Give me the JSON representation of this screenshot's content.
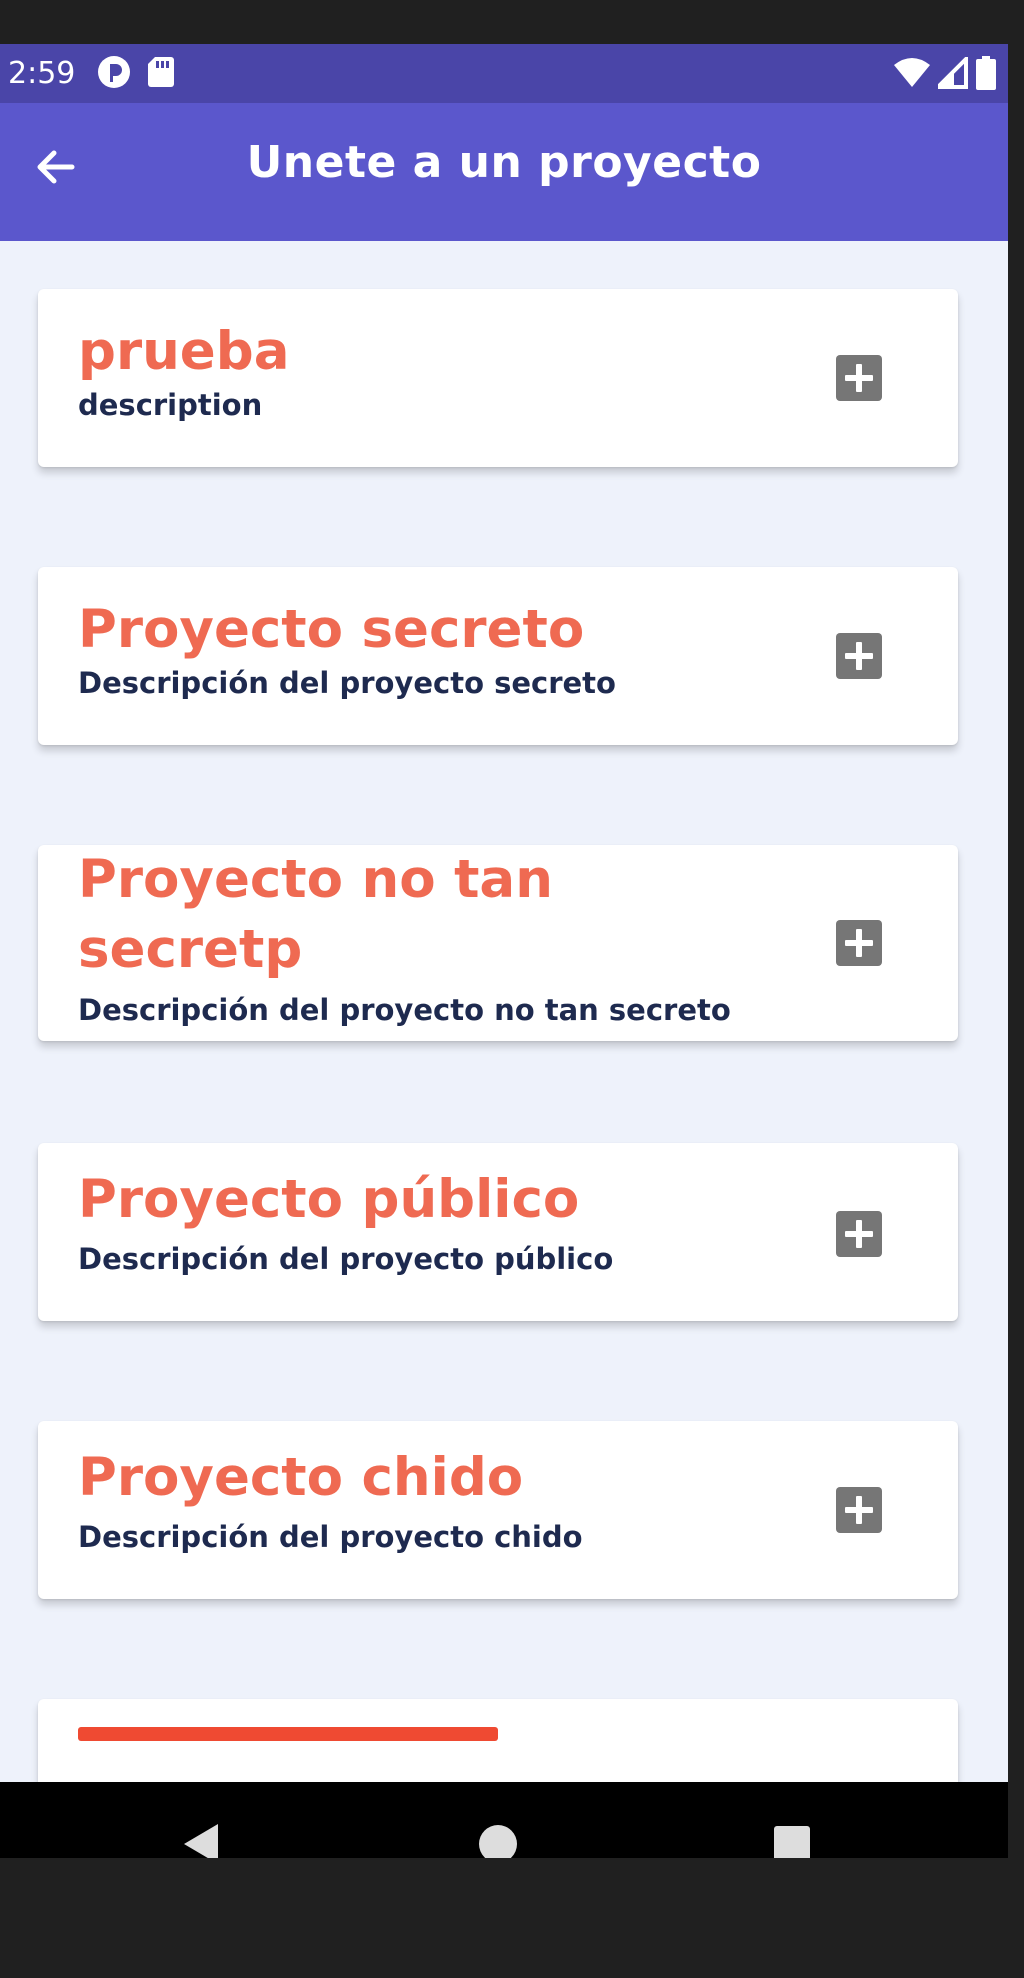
{
  "status_bar": {
    "time": "2:59",
    "icons": [
      "p-circle-icon",
      "sd-card-icon",
      "wifi-icon",
      "signal-icon",
      "battery-icon"
    ]
  },
  "app_bar": {
    "title": "Unete a un proyecto",
    "back_icon": "arrow-left-icon"
  },
  "projects": [
    {
      "title": "prueba",
      "description": "description"
    },
    {
      "title": "Proyecto secreto",
      "description": "Descripción del proyecto secreto"
    },
    {
      "title": "Proyecto no tan secretp",
      "description": "Descripción del proyecto no tan secreto"
    },
    {
      "title": "Proyecto público",
      "description": "Descripción del proyecto público"
    },
    {
      "title": "Proyecto chido",
      "description": "Descripción del proyecto chido"
    }
  ],
  "nav_bar": {
    "icons": [
      "back-triangle-icon",
      "home-circle-icon",
      "recents-square-icon"
    ]
  },
  "colors": {
    "status_bar": "#4a45a8",
    "app_bar": "#5b57cc",
    "background": "#eef2fb",
    "title_accent": "#ef6a52",
    "description": "#1e2a4f",
    "add_button": "#767676"
  }
}
